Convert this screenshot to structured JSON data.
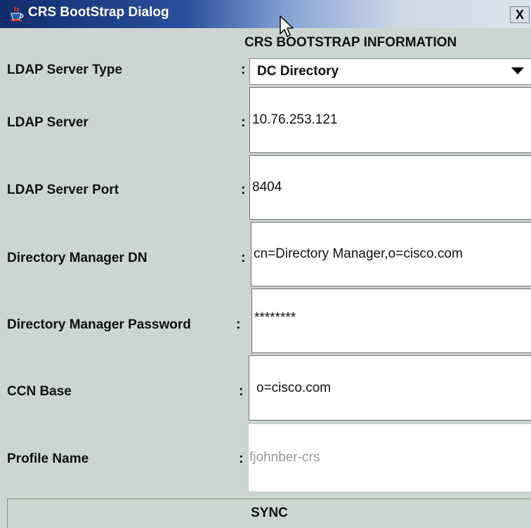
{
  "window": {
    "title": "CRS BootStrap Dialog",
    "close_label": "X"
  },
  "header": {
    "title": "CRS BOOTSTRAP INFORMATION"
  },
  "separator": ":",
  "fields": {
    "ldap_server_type": {
      "label": "LDAP Server Type",
      "value": "DC Directory"
    },
    "ldap_server": {
      "label": "LDAP Server",
      "value": "10.76.253.121"
    },
    "ldap_server_port": {
      "label": "LDAP Server Port",
      "value": "8404"
    },
    "directory_manager_dn": {
      "label": "Directory Manager DN",
      "value": "cn=Directory Manager,o=cisco.com"
    },
    "directory_manager_password": {
      "label": "Directory Manager Password",
      "value": "********"
    },
    "ccn_base": {
      "label": "CCN Base",
      "value": "o=cisco.com"
    },
    "profile_name": {
      "label": "Profile Name",
      "value": "fjohnber-crs"
    }
  },
  "actions": {
    "sync_label": "SYNC"
  },
  "icons": {
    "app": "java-cup-icon",
    "cursor": "mouse-pointer-icon",
    "dropdown": "dropdown-arrow-icon"
  }
}
